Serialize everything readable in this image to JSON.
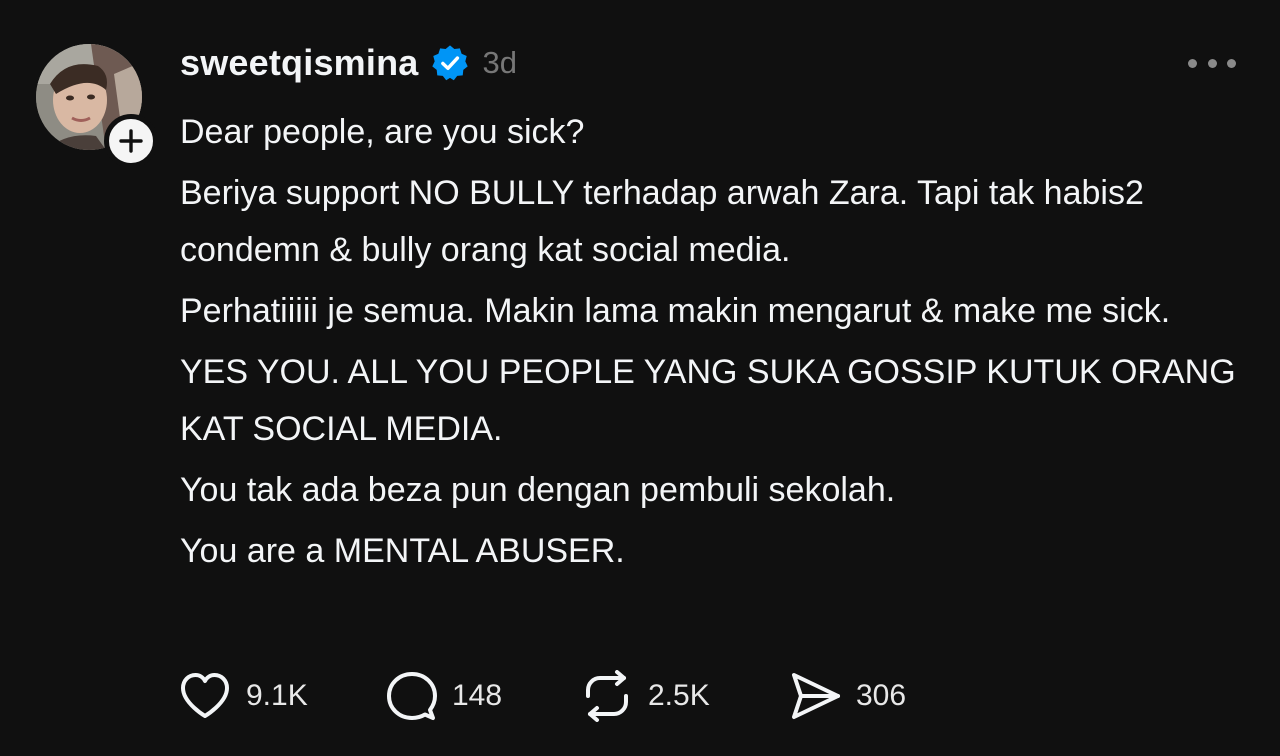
{
  "post": {
    "username": "sweetqismina",
    "time": "3d",
    "icons": {
      "verified": "verified-badge-icon",
      "follow": "plus-icon",
      "more": "more-icon"
    },
    "colors": {
      "background": "#101010",
      "text": "#f3f5f7",
      "muted": "#777777",
      "verified": "#0095f6"
    },
    "paragraphs": [
      "Dear people, are you sick?",
      "Beriya support NO BULLY terhadap arwah Zara. Tapi tak habis2 condemn & bully orang kat social media.",
      "Perhatiiiii je semua. Makin lama makin mengarut & make me sick.",
      "YES YOU. ALL YOU PEOPLE YANG SUKA GOSSIP KUTUK ORANG KAT SOCIAL MEDIA.",
      "You tak ada beza pun dengan pembuli sekolah.",
      "You are a MENTAL ABUSER."
    ],
    "actions": {
      "likes": "9.1K",
      "replies": "148",
      "reposts": "2.5K",
      "shares": "306"
    }
  }
}
